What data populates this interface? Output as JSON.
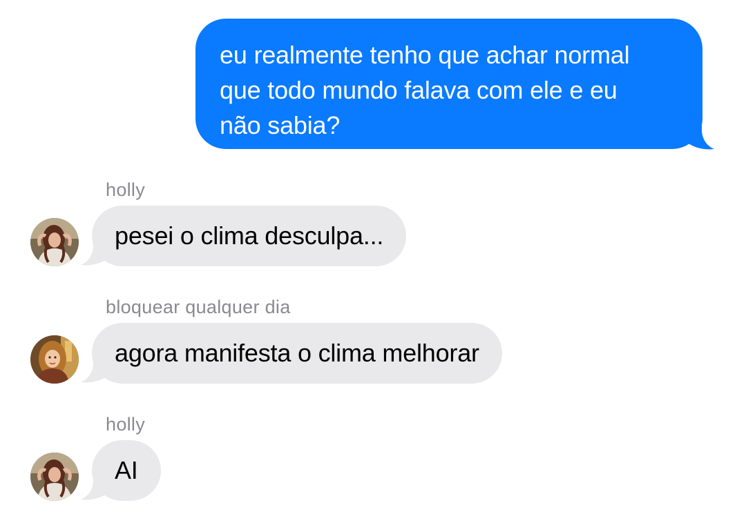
{
  "messages": [
    {
      "direction": "outgoing",
      "lines": [
        "eu realmente tenho que achar normal",
        "que todo mundo falava com ele e eu",
        "não sabia?"
      ]
    },
    {
      "direction": "incoming",
      "sender": "holly",
      "text": "pesei o clima desculpa..."
    },
    {
      "direction": "incoming",
      "sender": "bloquear qualquer dia",
      "text": "agora manifesta o clima melhorar"
    },
    {
      "direction": "incoming",
      "sender": "holly",
      "text": "AI"
    }
  ],
  "colors": {
    "outgoing_bubble": "#0a7aff",
    "incoming_bubble": "#e9e9eb",
    "sender_name": "#8a8a8e"
  },
  "icons": {
    "avatar_holly": "avatar-photo-icon",
    "avatar_bloquear": "avatar-photo-icon"
  }
}
